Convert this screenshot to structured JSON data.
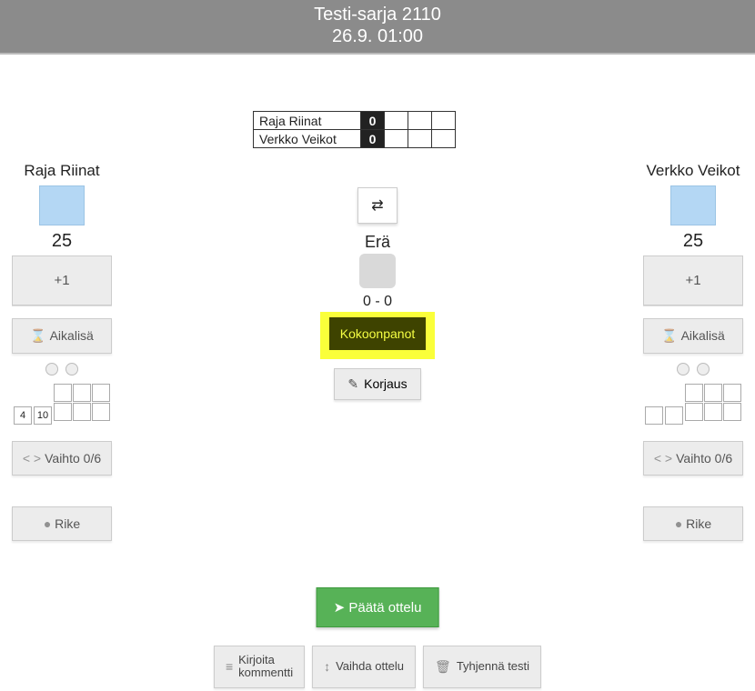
{
  "header": {
    "title": "Testi-sarja 2110",
    "datetime": "26.9. 01:00"
  },
  "score_table": {
    "rows": [
      {
        "name": "Raja Riinat",
        "score": "0"
      },
      {
        "name": "Verkko Veikot",
        "score": "0"
      }
    ]
  },
  "teams": {
    "left": {
      "name": "Raja Riinat",
      "target": "25",
      "plus_label": "+1",
      "timeout_label": "Aikalisä",
      "sub_label": "Vaihto  0/6",
      "foul_label": "Rike",
      "extra_numbers": [
        "4",
        "10"
      ]
    },
    "right": {
      "name": "Verkko Veikot",
      "target": "25",
      "plus_label": "+1",
      "timeout_label": "Aikalisä",
      "sub_label": "Vaihto  0/6",
      "foul_label": "Rike",
      "extra_numbers": [
        "",
        ""
      ]
    }
  },
  "center": {
    "era_label": "Erä",
    "era_score": "0  -  0",
    "lineups_label": "Kokoonpanot",
    "correction_label": "Korjaus"
  },
  "bottom": {
    "end_match": "Päätä ottelu",
    "write_comment_line1": "Kirjoita",
    "write_comment_line2": "kommentti",
    "switch_match": "Vaihda ottelu",
    "clear_test": "Tyhjennä testi"
  }
}
